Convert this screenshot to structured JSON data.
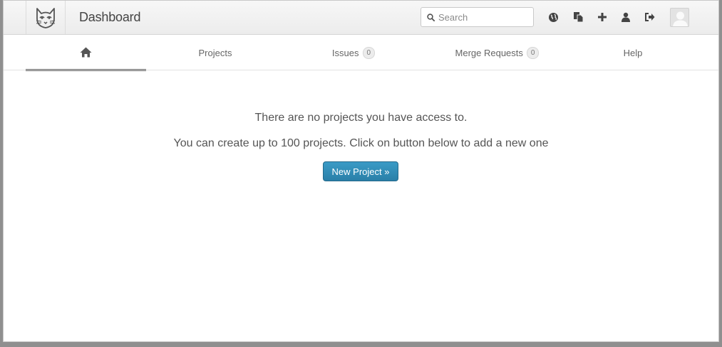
{
  "header": {
    "title": "Dashboard",
    "search": {
      "placeholder": "Search",
      "value": ""
    },
    "icons": [
      "logo-icon",
      "globe-icon",
      "copy-icon",
      "plus-icon",
      "user-icon",
      "sign-out-icon",
      "avatar"
    ]
  },
  "nav": {
    "tabs": [
      {
        "label": "",
        "icon": "home-icon",
        "active": true
      },
      {
        "label": "Projects"
      },
      {
        "label": "Issues",
        "badge": "0"
      },
      {
        "label": "Merge Requests",
        "badge": "0"
      },
      {
        "label": "Help"
      }
    ]
  },
  "main": {
    "empty_title": "There are no projects you have access to.",
    "empty_subtitle": "You can create up to 100 projects. Click on button below to add a new one",
    "new_project_label": "New Project »"
  },
  "colors": {
    "accent": "#2f8ab8",
    "header_bg": "#f0f0f0",
    "active_tab_border": "#666666"
  }
}
